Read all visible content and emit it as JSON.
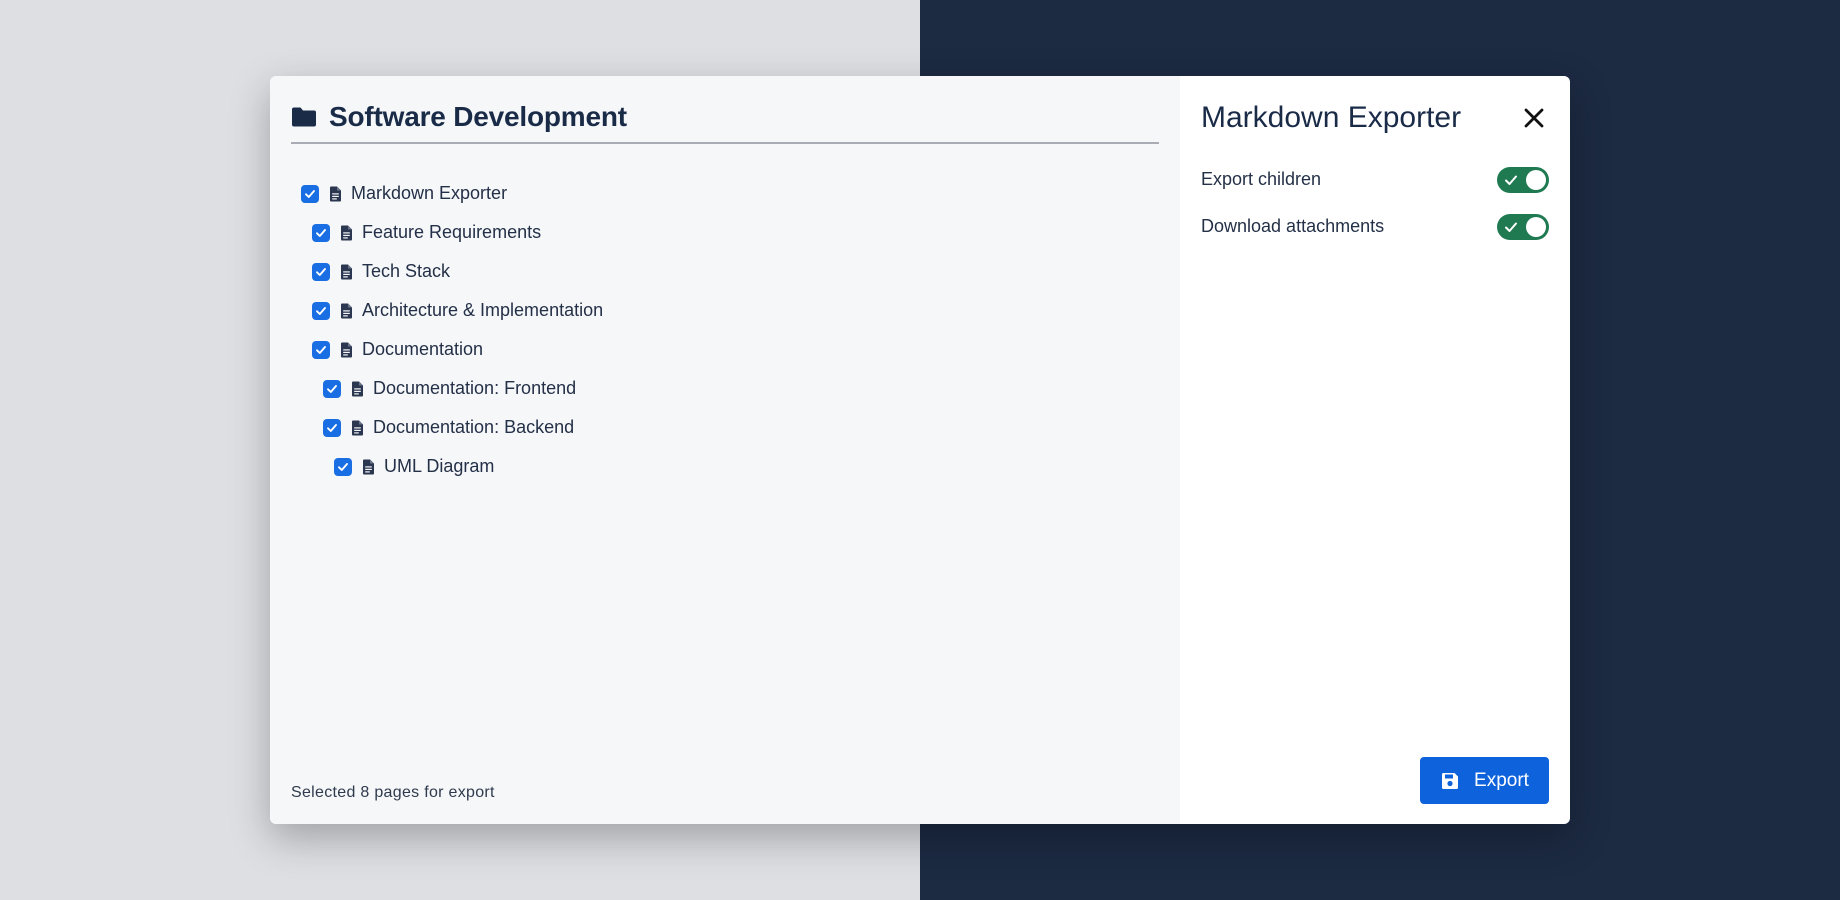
{
  "theme": {
    "accent": "#1a6ee3",
    "toggle_on": "#1f7a52",
    "export_button": "#0e62dc",
    "heading": "#1a2b48",
    "background_left": "#dddfe3",
    "background_right": "#1c2a42"
  },
  "space": {
    "icon": "folder-icon",
    "title": "Software Development"
  },
  "tree": [
    {
      "label": "Markdown Exporter",
      "depth": 0,
      "checked": true,
      "icon": "document-icon"
    },
    {
      "label": "Feature Requirements",
      "depth": 1,
      "checked": true,
      "icon": "document-icon"
    },
    {
      "label": "Tech Stack",
      "depth": 1,
      "checked": true,
      "icon": "document-icon"
    },
    {
      "label": "Architecture & Implementation",
      "depth": 1,
      "checked": true,
      "icon": "document-icon"
    },
    {
      "label": "Documentation",
      "depth": 1,
      "checked": true,
      "icon": "document-icon"
    },
    {
      "label": "Documentation: Frontend",
      "depth": 2,
      "checked": true,
      "icon": "document-icon"
    },
    {
      "label": "Documentation: Backend",
      "depth": 2,
      "checked": true,
      "icon": "document-icon"
    },
    {
      "label": "UML Diagram",
      "depth": 3,
      "checked": true,
      "icon": "document-icon"
    }
  ],
  "status": {
    "text": "Selected 8 pages for export"
  },
  "panel": {
    "title": "Markdown Exporter",
    "close_icon": "close-icon",
    "options": [
      {
        "label": "Export children",
        "enabled": true
      },
      {
        "label": "Download attachments",
        "enabled": true
      }
    ],
    "export_label": "Export",
    "export_icon": "save-icon"
  }
}
